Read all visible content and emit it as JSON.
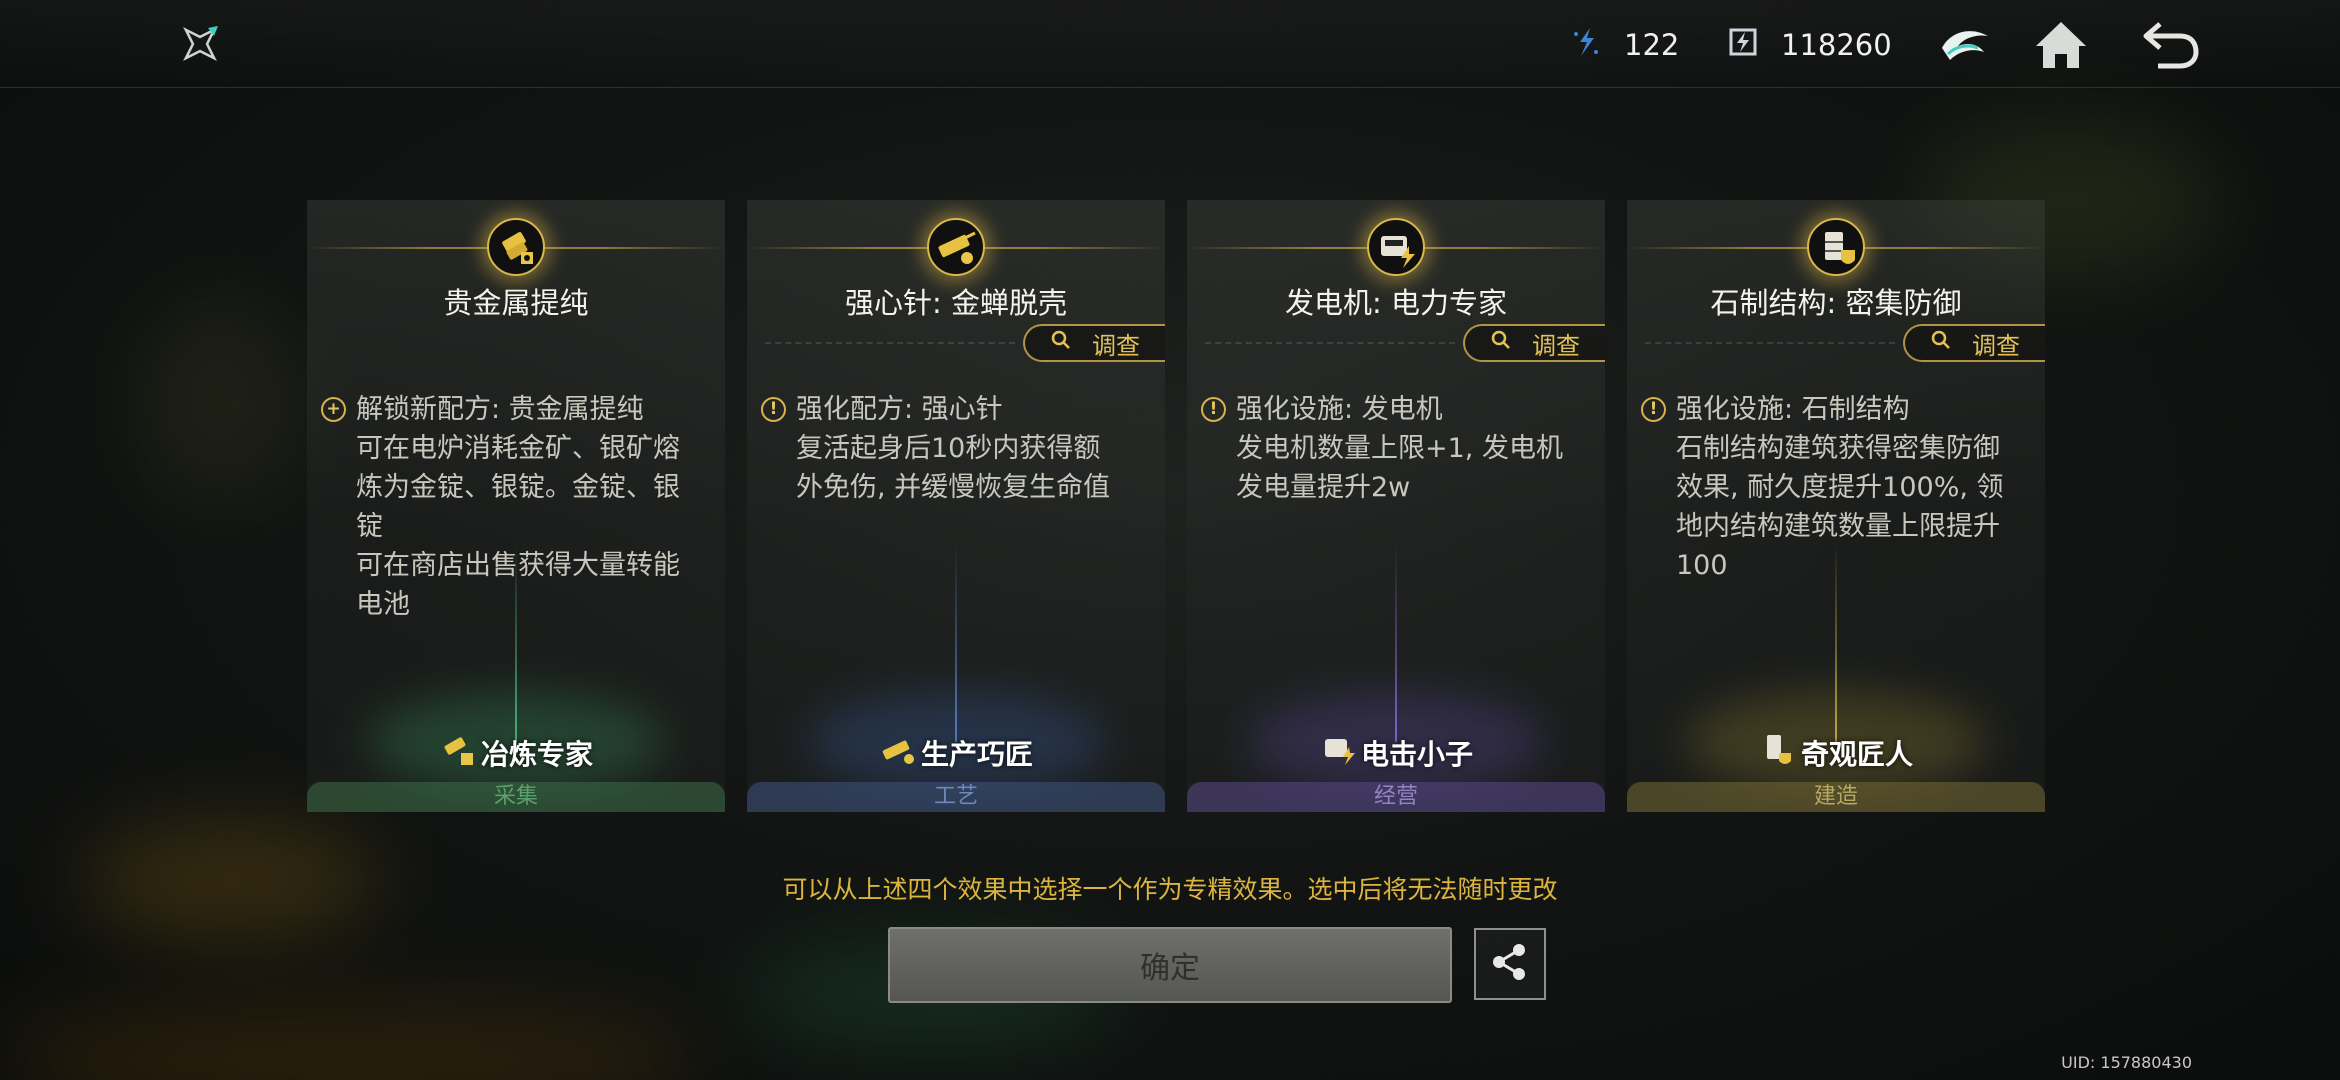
{
  "header": {
    "logo_icon": "shuriken-logo-icon",
    "resources": [
      {
        "icon": "crystal-icon",
        "value": "122"
      },
      {
        "icon": "battery-currency-icon",
        "value": "118260"
      }
    ],
    "buttons": [
      {
        "icon": "emblem-icon"
      },
      {
        "icon": "home-icon"
      },
      {
        "icon": "back-arrow-icon"
      }
    ]
  },
  "cards": [
    {
      "title": "贵金属提纯",
      "investigate": "",
      "effect_head": "解锁新配方: 贵金属提纯",
      "effect_lines": [
        "可在电炉消耗金矿、银矿熔",
        "炼为金锭、银锭。金锭、银锭",
        "可在商店出售获得大量转能",
        "电池"
      ],
      "talent": "冶炼专家",
      "category": "采集",
      "bullet": "+",
      "color": "#4f7a56"
    },
    {
      "title": "强心针: 金蝉脱壳",
      "investigate": "调查",
      "effect_head": "强化配方: 强心针",
      "effect_lines": [
        "复活起身后10秒内获得额",
        "外免伤, 并缓慢恢复生命值"
      ],
      "talent": "生产巧匠",
      "category": "工艺",
      "bullet": "!",
      "color": "#4a5f86"
    },
    {
      "title": "发电机: 电力专家",
      "investigate": "调查",
      "effect_head": "强化设施: 发电机",
      "effect_lines": [
        "发电机数量上限+1, 发电机",
        "发电量提升2w"
      ],
      "talent": "电击小子",
      "category": "经营",
      "bullet": "!",
      "color": "#6a5a8f"
    },
    {
      "title": "石制结构: 密集防御",
      "investigate": "调查",
      "effect_head": "强化设施: 石制结构",
      "effect_lines": [
        "石制结构建筑获得密集防御",
        "效果, 耐久度提升100%, 领",
        "地内结构建筑数量上限提升",
        "100"
      ],
      "talent": "奇观匠人",
      "category": "建造",
      "bullet": "!",
      "color": "#7c7340"
    }
  ],
  "hint": "可以从上述四个效果中选择一个作为专精效果。选中后将无法随时更改",
  "confirm_label": "确定",
  "share_icon": "share-icon",
  "uid": "UID: 157880430"
}
